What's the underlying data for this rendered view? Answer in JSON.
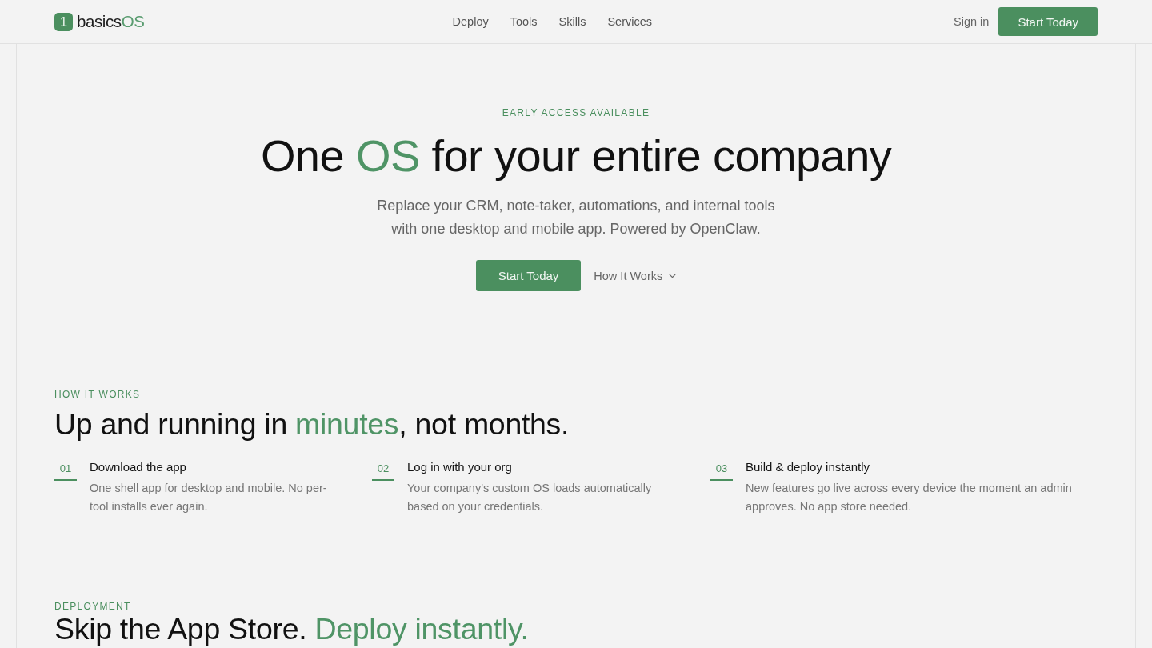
{
  "header": {
    "logo": {
      "mark": "1",
      "parts": [
        {
          "text": "basics",
          "accent": false
        },
        {
          "text": "OS",
          "accent": true
        }
      ]
    },
    "nav": [
      "Deploy",
      "Tools",
      "Skills",
      "Services"
    ],
    "sign_in": "Sign in",
    "cta": "Start Today"
  },
  "hero": {
    "eyebrow": "EARLY ACCESS AVAILABLE",
    "headline": [
      {
        "text": "One ",
        "accent": false
      },
      {
        "text": "OS",
        "accent": true
      },
      {
        "text": " for your entire company",
        "accent": false
      }
    ],
    "subtitle": "Replace your CRM, note-taker, automations, and internal tools with one desktop and mobile app. Powered by OpenClaw.",
    "primary_button": "Start Today",
    "secondary_link": "How It Works"
  },
  "how_it_works": {
    "eyebrow": "HOW IT WORKS",
    "heading": [
      {
        "text": "Up and running in ",
        "accent": false
      },
      {
        "text": "minutes",
        "accent": true
      },
      {
        "text": ", not months.",
        "accent": false
      }
    ],
    "steps": [
      {
        "number": "01",
        "title": "Download the app",
        "description": "One shell app for desktop and mobile. No per-tool installs ever again."
      },
      {
        "number": "02",
        "title": "Log in with your org",
        "description": "Your company's custom OS loads automatically based on your credentials."
      },
      {
        "number": "03",
        "title": "Build & deploy instantly",
        "description": "New features go live across every device the moment an admin approves. No app store needed."
      }
    ]
  },
  "deployment": {
    "eyebrow": "DEPLOYMENT",
    "heading": [
      {
        "text": "Skip the App Store. ",
        "accent": false
      },
      {
        "text": "Deploy instantly.",
        "accent": true
      }
    ]
  }
}
